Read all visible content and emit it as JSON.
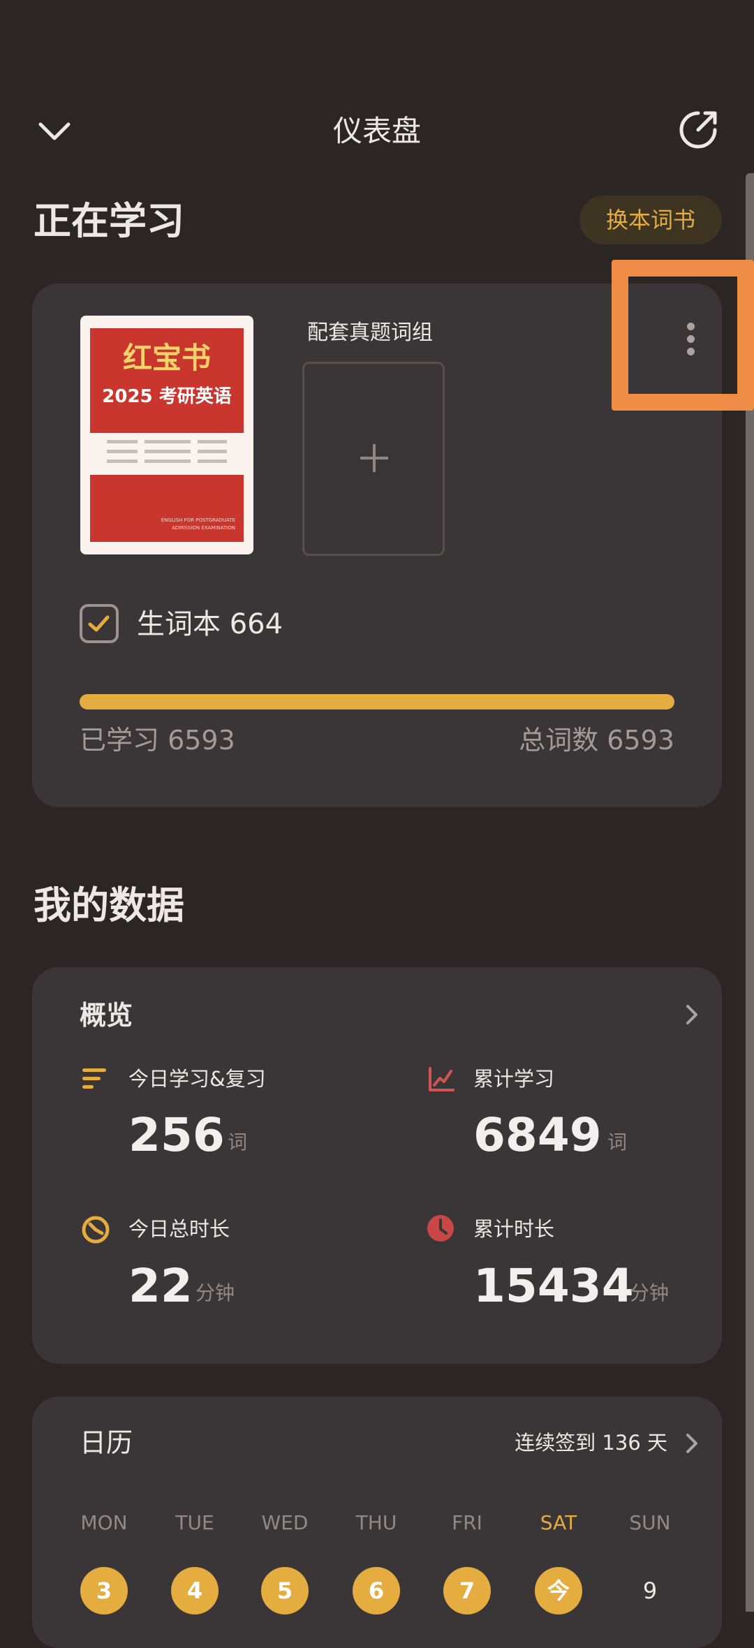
{
  "header": {
    "title": "仪表盘"
  },
  "studying": {
    "title": "正在学习",
    "switch_label": "换本词书",
    "cover": {
      "title": "红宝书",
      "subtitle": "2025 考研英语",
      "english": "ENGLISH FOR POSTGRADUATE ADMISSION EXAMINATION"
    },
    "group_label": "配套真题词组",
    "vocab_label": "生词本 664",
    "vocab_checked": true,
    "progress": 1.0,
    "learned": "已学习 6593",
    "total": "总词数 6593"
  },
  "my_data": {
    "title": "我的数据",
    "overview": {
      "title": "概览",
      "stats": [
        {
          "label": "今日学习&复习",
          "value": "256",
          "unit": "词",
          "icon": "bars-icon"
        },
        {
          "label": "累计学习",
          "value": "6849",
          "unit": "词",
          "icon": "line-chart-icon"
        },
        {
          "label": "今日总时长",
          "value": "22",
          "unit": "分钟",
          "icon": "timer-icon"
        },
        {
          "label": "累计时长",
          "value": "15434",
          "unit": "分钟",
          "icon": "clock-icon"
        }
      ]
    },
    "calendar": {
      "title": "日历",
      "streak": "连续签到 136 天",
      "weekdays": [
        "MON",
        "TUE",
        "WED",
        "THU",
        "FRI",
        "SAT",
        "SUN"
      ],
      "days": [
        {
          "label": "3",
          "checked": true
        },
        {
          "label": "4",
          "checked": true
        },
        {
          "label": "5",
          "checked": true
        },
        {
          "label": "6",
          "checked": true
        },
        {
          "label": "7",
          "checked": true
        },
        {
          "label": "今",
          "checked": true
        },
        {
          "label": "9",
          "checked": false
        }
      ]
    }
  },
  "colors": {
    "background": "#2b2524",
    "card": "#3a3537",
    "accent": "#e5ad3f",
    "highlight": "#ef8c45",
    "red": "#c8362e"
  }
}
